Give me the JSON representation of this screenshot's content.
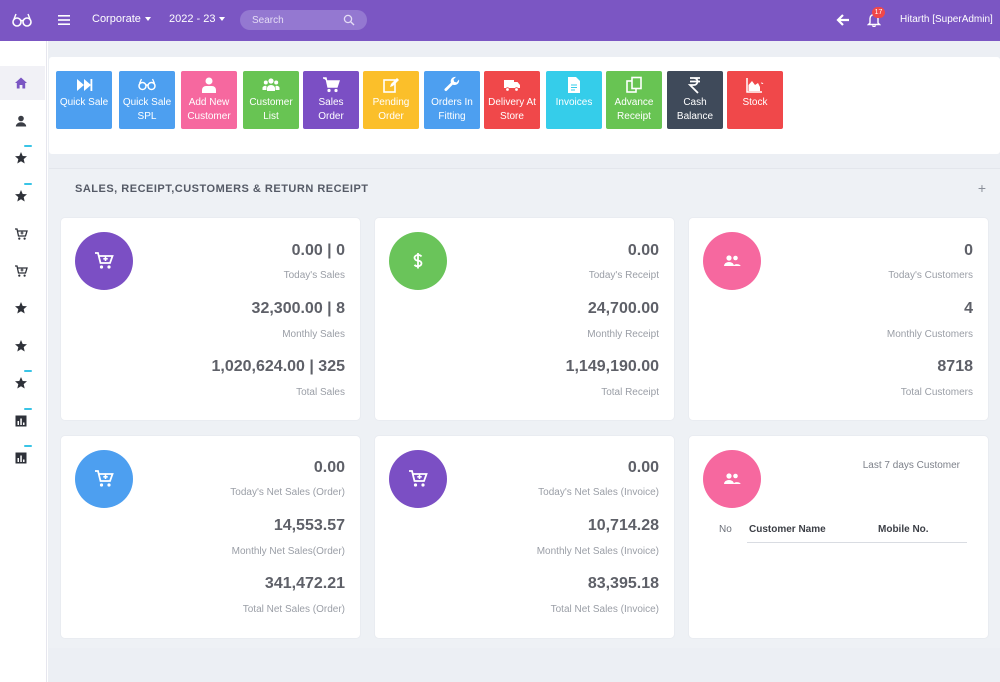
{
  "topbar": {
    "logo_icon": "glasses-icon",
    "branch": "Corporate",
    "year": "2022 - 23",
    "search_placeholder": "Search",
    "notification_count": "17",
    "user": "Hitarth [SuperAdmin]",
    "color": "#7b56c3"
  },
  "sidebar": {
    "items": [
      {
        "icon": "home-icon",
        "active": true
      },
      {
        "icon": "user-icon"
      },
      {
        "icon": "star-icon",
        "has_children": true
      },
      {
        "icon": "star-icon",
        "has_children": true
      },
      {
        "icon": "cart-icon"
      },
      {
        "icon": "cart-icon"
      },
      {
        "icon": "star-icon"
      },
      {
        "icon": "star-icon"
      },
      {
        "icon": "star-icon",
        "has_children": true
      },
      {
        "icon": "chart-icon",
        "has_children": true
      },
      {
        "icon": "chart-icon",
        "has_children": true
      }
    ]
  },
  "tiles": [
    {
      "label": "Quick Sale",
      "icon": "fast-forward-icon",
      "color": "#4d9ff0"
    },
    {
      "label": "Quick Sale SPL",
      "icon": "glasses-icon",
      "color": "#4d9ff0"
    },
    {
      "label": "Add New Customer",
      "icon": "user-icon",
      "color": "#f6689f"
    },
    {
      "label": "Customer List",
      "icon": "users-icon",
      "color": "#68c453"
    },
    {
      "label": "Sales Order",
      "icon": "cart-icon",
      "color": "#7b4fc4"
    },
    {
      "label": "Pending Order",
      "icon": "edit-icon",
      "color": "#fbbf2a"
    },
    {
      "label": "Orders In Fitting",
      "icon": "wrench-icon",
      "color": "#4d9ff0"
    },
    {
      "label": "Delivery At Store",
      "icon": "truck-icon",
      "color": "#f0484a"
    },
    {
      "label": "Invoices",
      "icon": "file-icon",
      "color": "#35cdea"
    },
    {
      "label": "Advance Receipt",
      "icon": "copy-icon",
      "color": "#68c453"
    },
    {
      "label": "Cash Balance",
      "icon": "rupee-icon",
      "color": "#3f4a5a"
    },
    {
      "label": "Stock",
      "icon": "area-chart-icon",
      "color": "#f0484a"
    }
  ],
  "section": {
    "title": "SALES, RECEIPT,CUSTOMERS & RETURN RECEIPT"
  },
  "cards": {
    "sales": {
      "icon": "cart-icon",
      "color": "#7b4fc4",
      "today_value": "0.00 | 0",
      "today_label": "Today's Sales",
      "monthly_value": "32,300.00 | 8",
      "monthly_label": "Monthly Sales",
      "total_value": "1,020,624.00 | 325",
      "total_label": "Total Sales"
    },
    "receipt": {
      "icon": "dollar-icon",
      "color": "#6ac45a",
      "today_value": "0.00",
      "today_label": "Today's Receipt",
      "monthly_value": "24,700.00",
      "monthly_label": "Monthly Receipt",
      "total_value": "1,149,190.00",
      "total_label": "Total Receipt"
    },
    "customers": {
      "icon": "users-icon",
      "color": "#f6689f",
      "today_value": "0",
      "today_label": "Today's Customers",
      "monthly_value": "4",
      "monthly_label": "Monthly Customers",
      "total_value": "8718",
      "total_label": "Total Customers"
    },
    "net_order": {
      "icon": "cart-icon",
      "color": "#4d9ff0",
      "today_value": "0.00",
      "today_label": "Today's Net Sales (Order)",
      "monthly_value": "14,553.57",
      "monthly_label": "Monthly Net Sales(Order)",
      "total_value": "341,472.21",
      "total_label": "Total Net Sales (Order)"
    },
    "net_invoice": {
      "icon": "cart-icon",
      "color": "#7b4fc4",
      "today_value": "0.00",
      "today_label": "Today's Net Sales (Invoice)",
      "monthly_value": "10,714.28",
      "monthly_label": "Monthly Net Sales (Invoice)",
      "total_value": "83,395.18",
      "total_label": "Total Net Sales (Invoice)"
    },
    "last7": {
      "icon": "users-icon",
      "color": "#f6689f",
      "title": "Last 7 days Customer",
      "columns": [
        "No",
        "Customer Name",
        "Mobile No."
      ]
    }
  }
}
